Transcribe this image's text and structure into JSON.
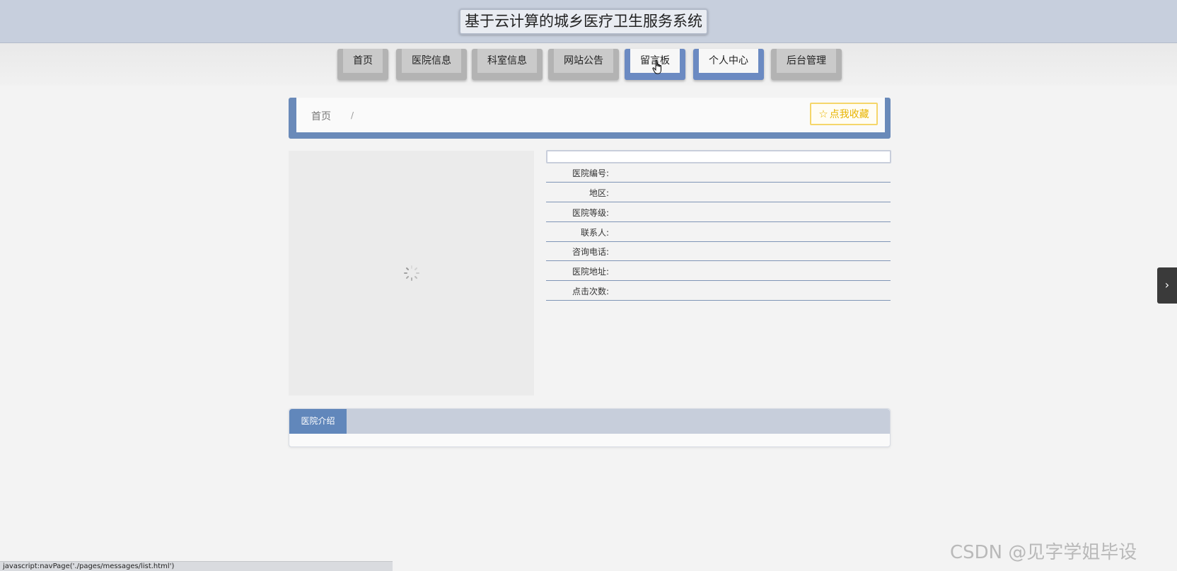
{
  "header": {
    "site_title": "基于云计算的城乡医疗卫生服务系统"
  },
  "nav": {
    "items": [
      {
        "label": "首页",
        "active": false
      },
      {
        "label": "医院信息",
        "active": false
      },
      {
        "label": "科室信息",
        "active": false
      },
      {
        "label": "网站公告",
        "active": false
      },
      {
        "label": "留言板",
        "active": true
      },
      {
        "label": "个人中心",
        "active": true
      },
      {
        "label": "后台管理",
        "active": false
      }
    ]
  },
  "breadcrumb": {
    "home": "首页",
    "separator": "/"
  },
  "favorite": {
    "icon": "star-icon",
    "label": "点我收藏"
  },
  "hospital": {
    "name": "",
    "fields": [
      {
        "label": "医院编号:",
        "value": ""
      },
      {
        "label": "地区:",
        "value": ""
      },
      {
        "label": "医院等级:",
        "value": ""
      },
      {
        "label": "联系人:",
        "value": ""
      },
      {
        "label": "咨询电话:",
        "value": ""
      },
      {
        "label": "医院地址:",
        "value": ""
      },
      {
        "label": "点击次数:",
        "value": ""
      }
    ]
  },
  "intro": {
    "tab_label": "医院介绍"
  },
  "side_toggle": {
    "icon": "chevron-right-icon",
    "glyph": "›"
  },
  "status_bar": {
    "text": "javascript:navPage('./pages/messages/list.html')"
  },
  "watermark": {
    "text": "CSDN @见字学姐毕设"
  },
  "colors": {
    "accent": "#6a8ab9",
    "header_bg": "#c7cfdd",
    "favorite": "#e8b400"
  }
}
